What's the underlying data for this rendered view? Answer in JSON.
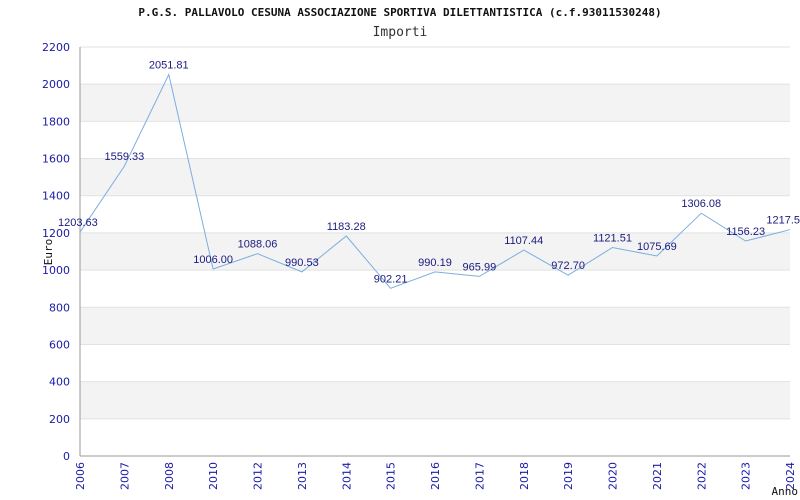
{
  "page": {
    "title": "P.G.S. PALLAVOLO CESUNA ASSOCIAZIONE SPORTIVA DILETTANTISTICA (c.f.93011530248)"
  },
  "chart_data": {
    "type": "line",
    "title": "Importi",
    "xlabel": "Anno",
    "ylabel": "Euro",
    "ylim": [
      0,
      2200
    ],
    "yticks": [
      0,
      200,
      400,
      600,
      800,
      1000,
      1200,
      1400,
      1600,
      1800,
      2000,
      2200
    ],
    "grid": true,
    "categories": [
      "2006",
      "2007",
      "2008",
      "2010",
      "2012",
      "2013",
      "2014",
      "2015",
      "2016",
      "2017",
      "2018",
      "2019",
      "2020",
      "2021",
      "2022",
      "2023",
      "2024"
    ],
    "values": [
      1203.63,
      1559.33,
      2051.81,
      1006.0,
      1088.06,
      990.53,
      1183.28,
      902.21,
      990.19,
      965.99,
      1107.44,
      972.7,
      1121.51,
      1075.69,
      1306.08,
      1156.23,
      1217.5
    ],
    "value_labels": [
      "1203.63",
      "1559.33",
      "2051.81",
      "1006.00",
      "1088.06",
      "990.53",
      "1183.28",
      "902.21",
      "990.19",
      "965.99",
      "1107.44",
      "972.70",
      "1121.51",
      "1075.69",
      "1306.08",
      "1156.23",
      "1217.5"
    ],
    "colors": {
      "line": "#7aaee0",
      "band": "#f3f3f3",
      "tick_text": "#1a1aa8",
      "label_text": "#1a1a80"
    }
  }
}
